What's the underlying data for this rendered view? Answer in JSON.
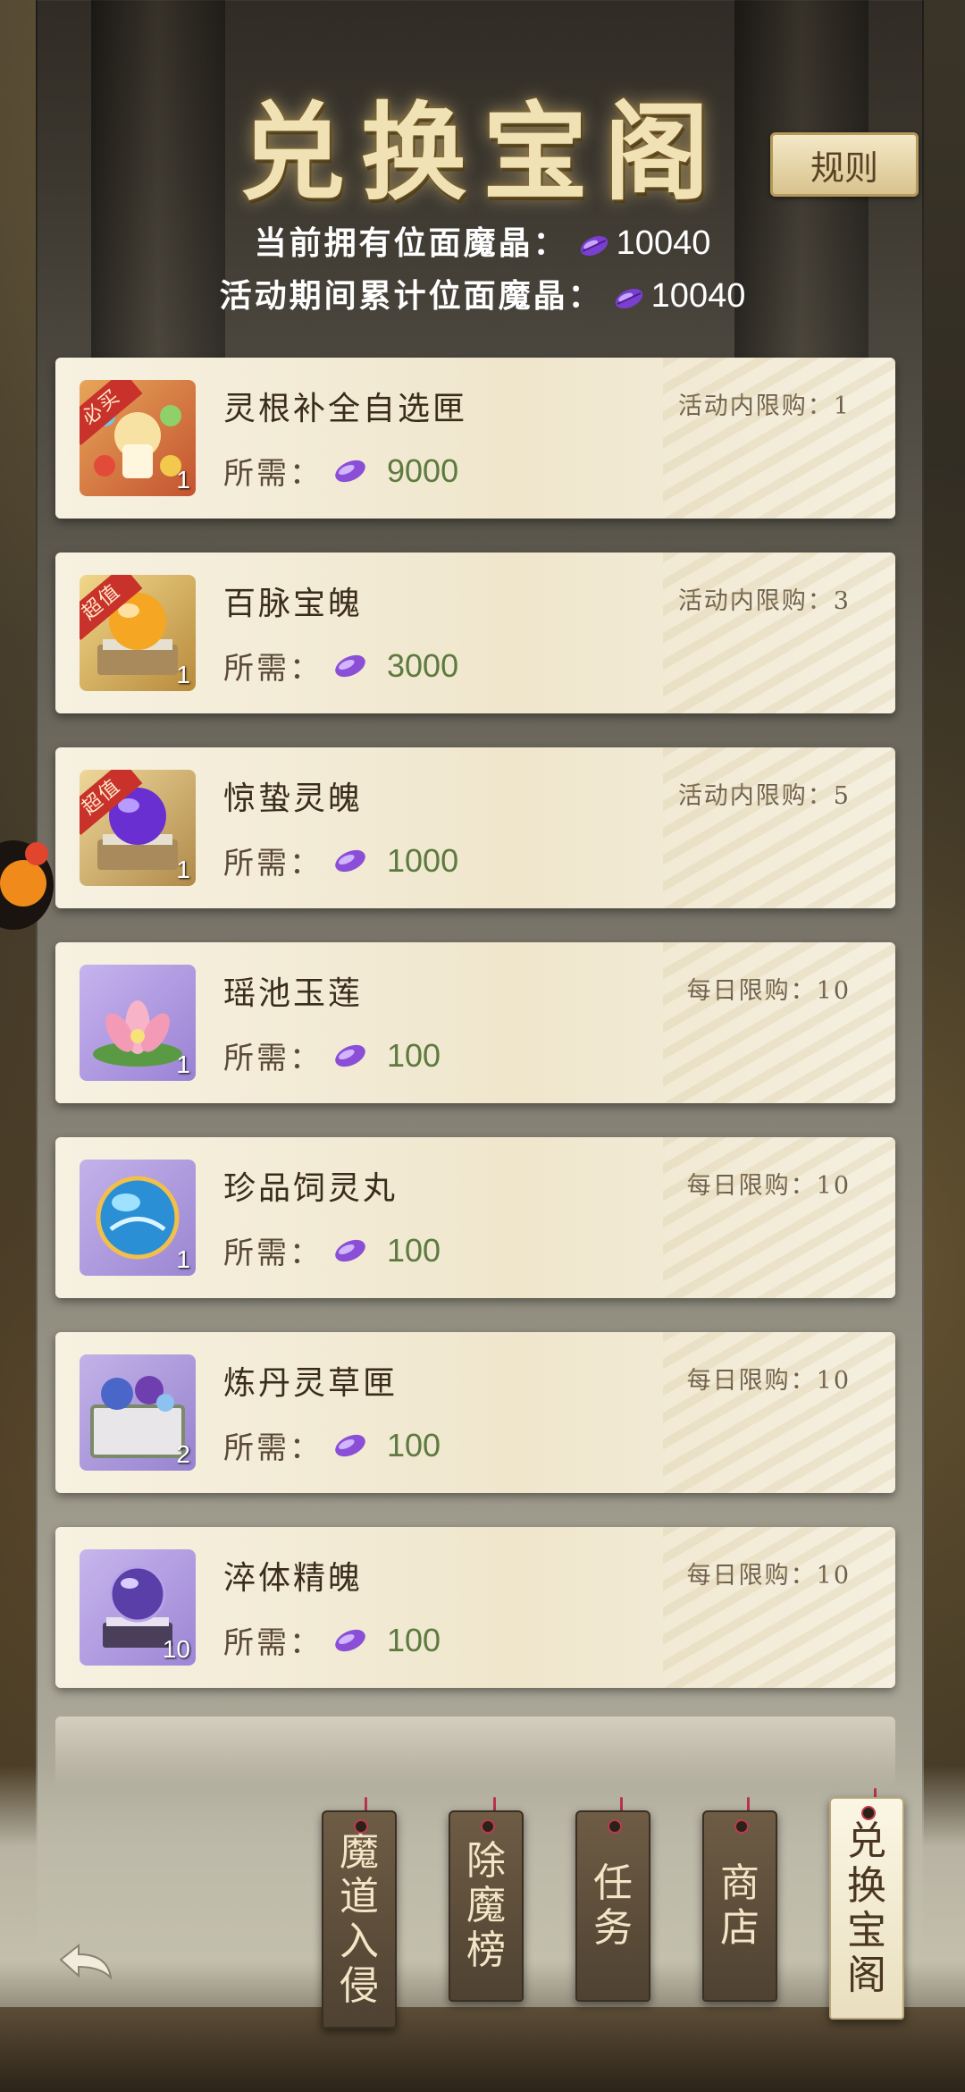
{
  "header": {
    "title": "兑换宝阁",
    "rules_label": "规则",
    "current_label": "当前拥有位面魔晶：",
    "current_value": "10040",
    "total_label": "活动期间累计位面魔晶：",
    "total_value": "10040"
  },
  "currency_icon": "purple-crystal-icon",
  "items": [
    {
      "name": "灵根补全自选匣",
      "limit": "活动内限购：1",
      "cost_label": "所需：",
      "cost": "9000",
      "count": "1",
      "badge": "必买",
      "icon": "spirit-root-box-icon"
    },
    {
      "name": "百脉宝魄",
      "limit": "活动内限购：3",
      "cost_label": "所需：",
      "cost": "3000",
      "count": "1",
      "badge": "超值",
      "icon": "golden-orb-icon"
    },
    {
      "name": "惊蛰灵魄",
      "limit": "活动内限购：5",
      "cost_label": "所需：",
      "cost": "1000",
      "count": "1",
      "badge": "超值",
      "icon": "purple-orb-icon"
    },
    {
      "name": "瑶池玉莲",
      "limit": "每日限购：10",
      "cost_label": "所需：",
      "cost": "100",
      "count": "1",
      "badge": "",
      "icon": "lotus-icon"
    },
    {
      "name": "珍品饲灵丸",
      "limit": "每日限购：10",
      "cost_label": "所需：",
      "cost": "100",
      "count": "1",
      "badge": "",
      "icon": "blue-pill-icon"
    },
    {
      "name": "炼丹灵草匣",
      "limit": "每日限购：10",
      "cost_label": "所需：",
      "cost": "100",
      "count": "2",
      "badge": "",
      "icon": "herb-chest-icon"
    },
    {
      "name": "淬体精魄",
      "limit": "每日限购：10",
      "cost_label": "所需：",
      "cost": "100",
      "count": "10",
      "badge": "",
      "icon": "crystal-ball-icon"
    }
  ],
  "nav_tags": [
    {
      "label": "魔道入侵",
      "active": false
    },
    {
      "label": "除魔榜",
      "active": false
    },
    {
      "label": "任务",
      "active": false
    },
    {
      "label": "商店",
      "active": false
    },
    {
      "label": "兑换宝阁",
      "active": true
    }
  ],
  "back_icon": "back-arrow-icon",
  "colors": {
    "cost_green": "#5d7a3f",
    "crystal_purple": "#8a4fd6",
    "badge_red": "#c8322a"
  }
}
